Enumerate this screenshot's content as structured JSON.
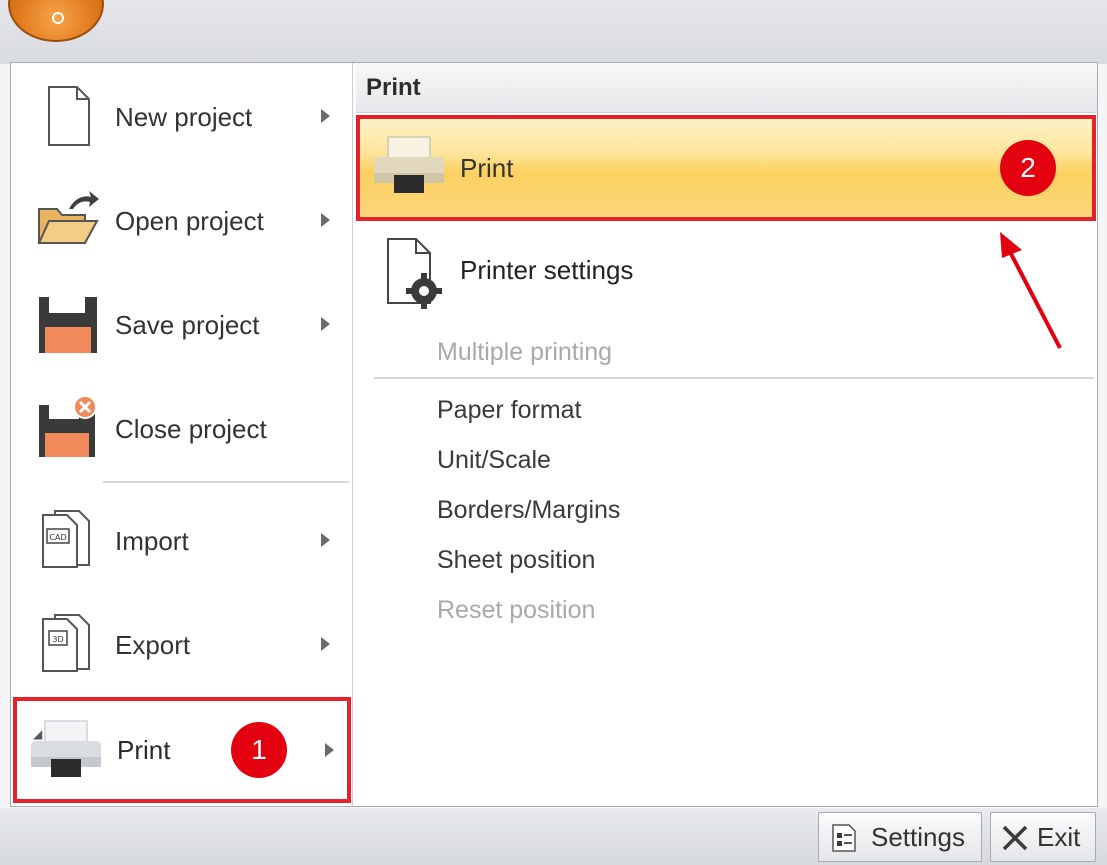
{
  "left_menu": {
    "items": [
      {
        "label": "New project",
        "icon": "new-document-icon",
        "has_submenu": true
      },
      {
        "label": "Open project",
        "icon": "open-folder-icon",
        "has_submenu": true
      },
      {
        "label": "Save project",
        "icon": "floppy-disk-icon",
        "has_submenu": true
      },
      {
        "label": "Close project",
        "icon": "close-floppy-icon",
        "has_submenu": false
      },
      {
        "label": "Import",
        "icon": "cad-import-icon",
        "has_submenu": true
      },
      {
        "label": "Export",
        "icon": "3d-export-icon",
        "has_submenu": true
      },
      {
        "label": "Print",
        "icon": "printer-icon",
        "has_submenu": true,
        "highlighted": true,
        "badge": "1"
      }
    ]
  },
  "submenu": {
    "title": "Print",
    "print_action": {
      "label": "Print",
      "icon": "printer-icon",
      "badge": "2"
    },
    "printer_settings": {
      "label": "Printer settings",
      "icon": "printer-settings-icon"
    },
    "items": [
      {
        "label": "Multiple printing",
        "enabled": false
      },
      {
        "label": "Paper format",
        "enabled": true
      },
      {
        "label": "Unit/Scale",
        "enabled": true
      },
      {
        "label": "Borders/Margins",
        "enabled": true
      },
      {
        "label": "Sheet position",
        "enabled": true
      },
      {
        "label": "Reset position",
        "enabled": false
      }
    ]
  },
  "footer": {
    "settings_label": "Settings",
    "exit_label": "Exit"
  },
  "colors": {
    "highlight_border": "#e8202a",
    "badge": "#e3000f",
    "hover_gold": "#fbd15f",
    "disabled_text": "#a9a9a9"
  }
}
